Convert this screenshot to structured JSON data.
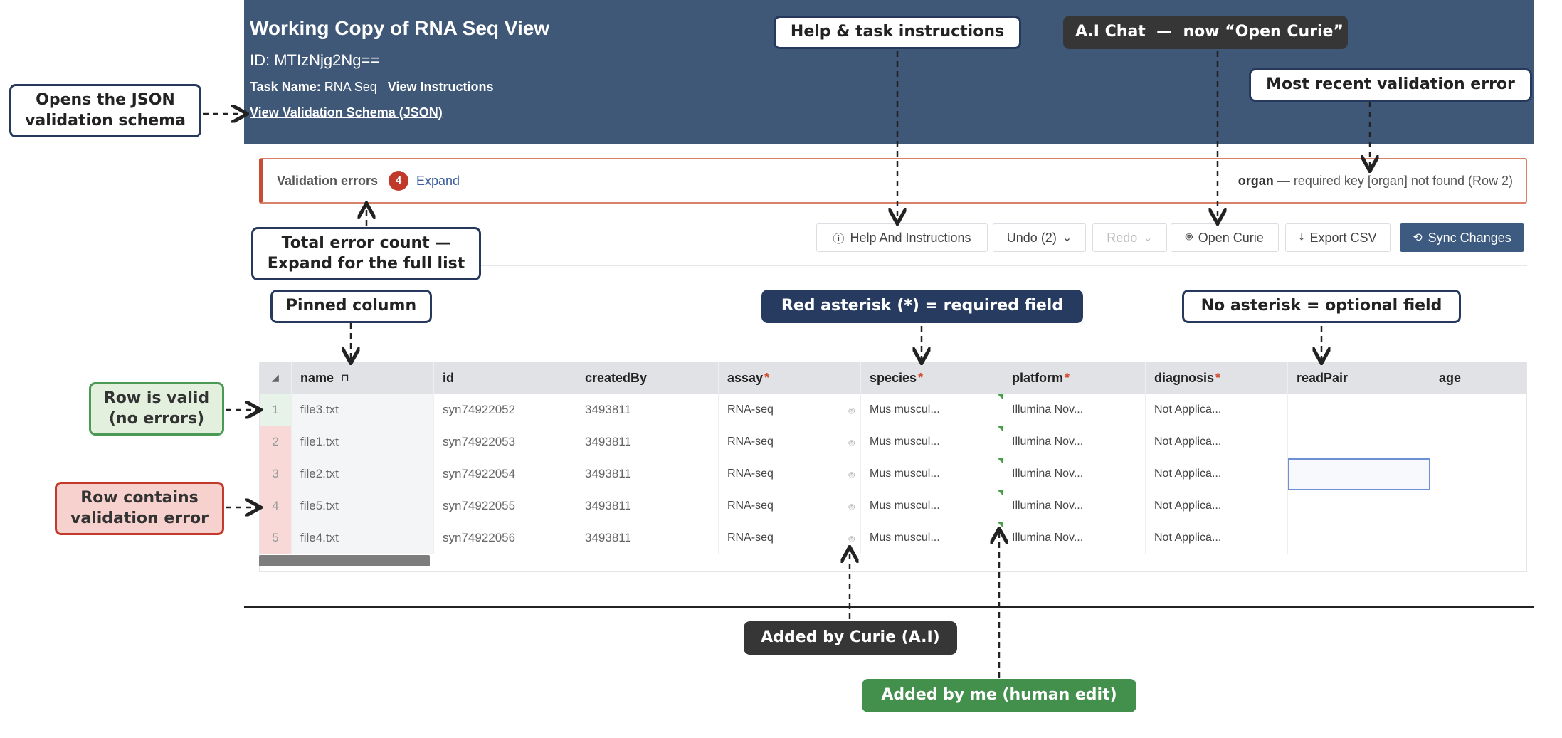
{
  "header": {
    "title": "Working Copy of RNA Seq View",
    "id_text": "ID: MTIzNjg2Ng==",
    "task_label": "Task Name:",
    "task_name": "RNA Seq",
    "view_instructions": "View Instructions",
    "schema_link": "View Validation Schema (JSON)"
  },
  "validation": {
    "label": "Validation errors",
    "count": "4",
    "expand": "Expand",
    "latest_key": "organ",
    "latest_msg": "— required key [organ] not found (Row 2)"
  },
  "toolbar": {
    "help": "Help And Instructions",
    "undo": "Undo (2)",
    "redo": "Redo",
    "curie": "Open Curie",
    "export": "Export CSV",
    "sync": "Sync Changes"
  },
  "grid": {
    "columns": [
      "name",
      "id",
      "createdBy",
      "assay",
      "species",
      "platform",
      "diagnosis",
      "readPair",
      "age"
    ],
    "rows": [
      {
        "num": "1",
        "name": "file3.txt",
        "id": "syn74922052",
        "createdBy": "3493811",
        "assay": "RNA-seq",
        "species": "Mus muscul...",
        "platform": "Illumina Nov...",
        "diagnosis": "Not Applica..."
      },
      {
        "num": "2",
        "name": "file1.txt",
        "id": "syn74922053",
        "createdBy": "3493811",
        "assay": "RNA-seq",
        "species": "Mus muscul...",
        "platform": "Illumina Nov...",
        "diagnosis": "Not Applica..."
      },
      {
        "num": "3",
        "name": "file2.txt",
        "id": "syn74922054",
        "createdBy": "3493811",
        "assay": "RNA-seq",
        "species": "Mus muscul...",
        "platform": "Illumina Nov...",
        "diagnosis": "Not Applica..."
      },
      {
        "num": "4",
        "name": "file5.txt",
        "id": "syn74922055",
        "createdBy": "3493811",
        "assay": "RNA-seq",
        "species": "Mus muscul...",
        "platform": "Illumina Nov...",
        "diagnosis": "Not Applica..."
      },
      {
        "num": "5",
        "name": "file4.txt",
        "id": "syn74922056",
        "createdBy": "3493811",
        "assay": "RNA-seq",
        "species": "Mus muscul...",
        "platform": "Illumina Nov...",
        "diagnosis": "Not Applica..."
      }
    ]
  },
  "callouts": {
    "json_schema": "Opens the JSON\nvalidation schema",
    "help": "Help & task instructions",
    "ai_chat": "A.I Chat  —  now “Open Curie”",
    "recent_error": "Most recent validation error",
    "error_count": "Total error count —\nExpand for the full list",
    "pinned": "Pinned column",
    "required": "Red asterisk (*) = required field",
    "optional": "No asterisk = optional field",
    "row_valid": "Row is valid\n(no errors)",
    "row_error": "Row contains\nvalidation error",
    "curie_added": "Added by Curie (A.I)",
    "human_added": "Added by me (human edit)"
  },
  "icons": {
    "help": "question-circle-icon",
    "undo_caret": "chevron-down-icon",
    "curie": "robot-icon",
    "export": "download-icon",
    "sync": "sync-icon",
    "pin": "pin-icon",
    "corner": "select-all-triangle-icon"
  },
  "colors": {
    "header_bg": "#405878",
    "error_red": "#c0392b",
    "valid_row": "#e7f3e9",
    "invalid_row": "#f8d9d7",
    "primary_button": "#3d5a80",
    "human_edit_marker": "#43a047"
  }
}
